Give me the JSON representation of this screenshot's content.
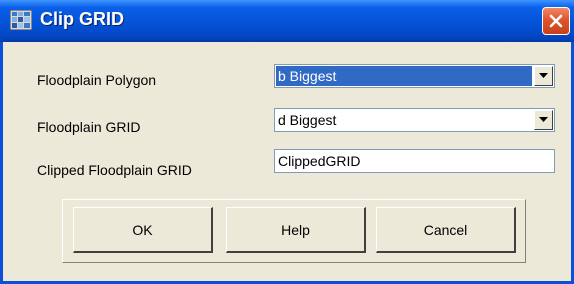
{
  "window": {
    "title": "Clip GRID",
    "icon": "grid-app-icon",
    "close_icon": "close-x-icon"
  },
  "fields": {
    "floodplain_polygon": {
      "label": "Floodplain Polygon",
      "value": "b Biggest"
    },
    "floodplain_grid": {
      "label": "Floodplain GRID",
      "value": "d Biggest"
    },
    "clipped_grid": {
      "label": "Clipped Floodplain GRID",
      "value": "ClippedGRID"
    }
  },
  "buttons": {
    "ok": "OK",
    "help": "Help",
    "cancel": "Cancel"
  },
  "colors": {
    "titlebar": "#0553d8",
    "close_button": "#e0542c",
    "selection": "#316ac5",
    "dialog_background": "#ece9d8"
  }
}
